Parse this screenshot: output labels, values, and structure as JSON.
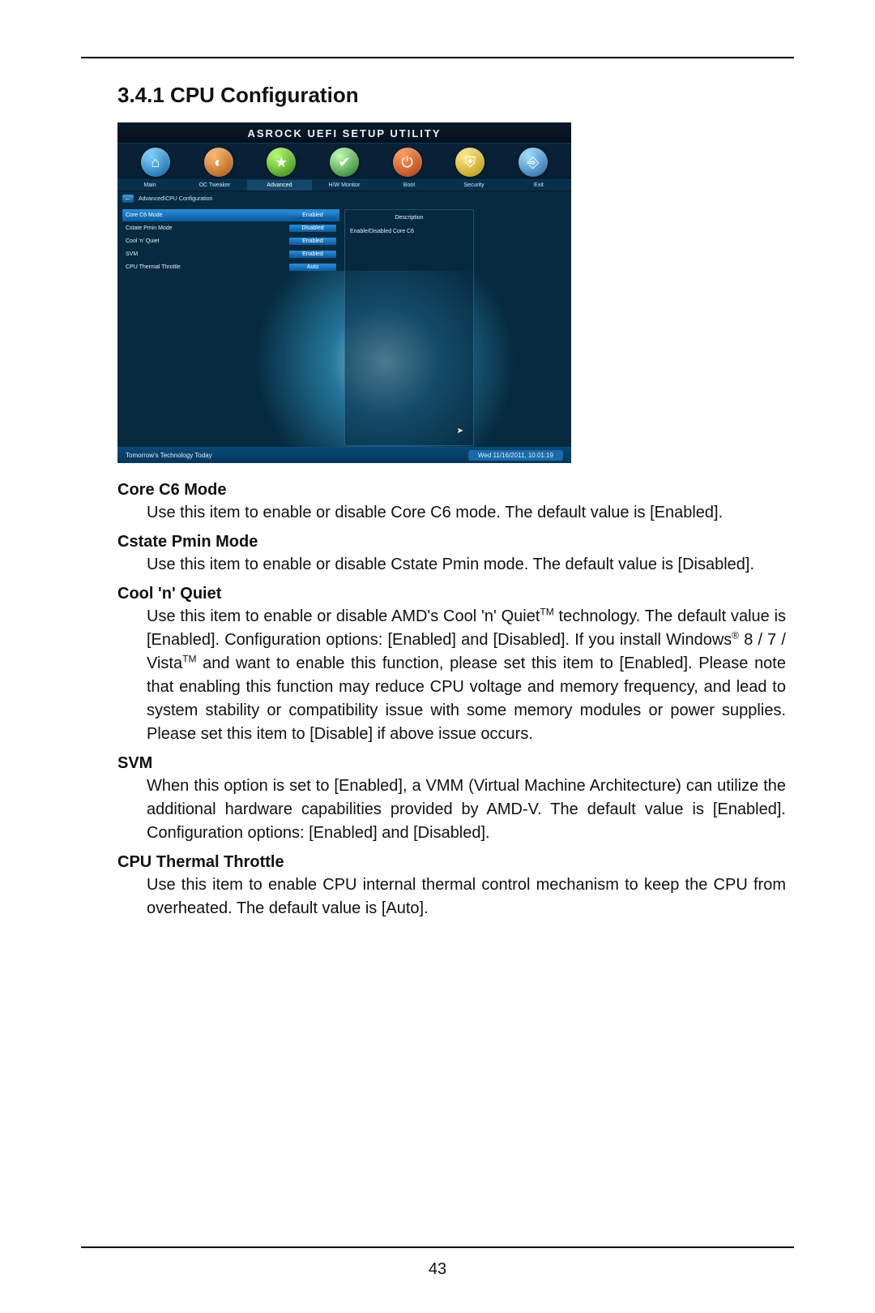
{
  "page": {
    "section_title": "3.4.1  CPU Configuration",
    "page_number": "43"
  },
  "bios": {
    "title": "ASROCK UEFI SETUP UTILITY",
    "tabs": [
      "Main",
      "OC Tweaker",
      "Advanced",
      "H/W Monitor",
      "Boot",
      "Security",
      "Exit"
    ],
    "active_tab_index": 2,
    "breadcrumb": "Advanced\\CPU Configuration",
    "settings": [
      {
        "label": "Core C6 Mode",
        "value": "Enabled",
        "selected": true
      },
      {
        "label": "Cstate Pmin Mode",
        "value": "Disabled",
        "selected": false
      },
      {
        "label": "Cool 'n' Quiet",
        "value": "Enabled",
        "selected": false
      },
      {
        "label": "SVM",
        "value": "Enabled",
        "selected": false
      },
      {
        "label": "CPU Thermal Throttle",
        "value": "Auto",
        "selected": false
      }
    ],
    "description_title": "Description",
    "description_text": "Enable/Disabled Core C6",
    "footer_tagline": "Tomorrow's Technology Today",
    "footer_time": "Wed 11/16/2011, 10:01:19"
  },
  "items": [
    {
      "title": "Core C6 Mode",
      "desc": "Use this item to enable or disable Core C6 mode. The default value is [Enabled]."
    },
    {
      "title": "Cstate Pmin Mode",
      "desc": "Use this item to enable or disable Cstate Pmin mode. The default value is [Disabled]."
    },
    {
      "title": "Cool 'n' Quiet",
      "desc_html": "Use this item to enable or disable AMD's Cool 'n' Quiet<sup>TM</sup> technology. The default value is [Enabled]. Configuration options: [Enabled] and [Disabled]. If you install Windows<sup>®</sup> 8 / 7 / Vista<sup>TM</sup> and want to enable this function, please set this item to [Enabled]. Please note that enabling this function may reduce CPU voltage and memory frequency, and lead to system stability or compatibility issue with some memory modules or power supplies. Please set this item to [Disable] if above issue occurs."
    },
    {
      "title": "SVM",
      "desc": "When this option is set to [Enabled], a VMM (Virtual Machine Architecture) can utilize the additional hardware capabilities provided by AMD-V. The default value is [Enabled]. Configuration options: [Enabled] and [Disabled]."
    },
    {
      "title": "CPU Thermal Throttle",
      "desc": "Use this item to enable CPU internal thermal control mechanism to keep the CPU from overheated. The default value is [Auto]."
    }
  ]
}
